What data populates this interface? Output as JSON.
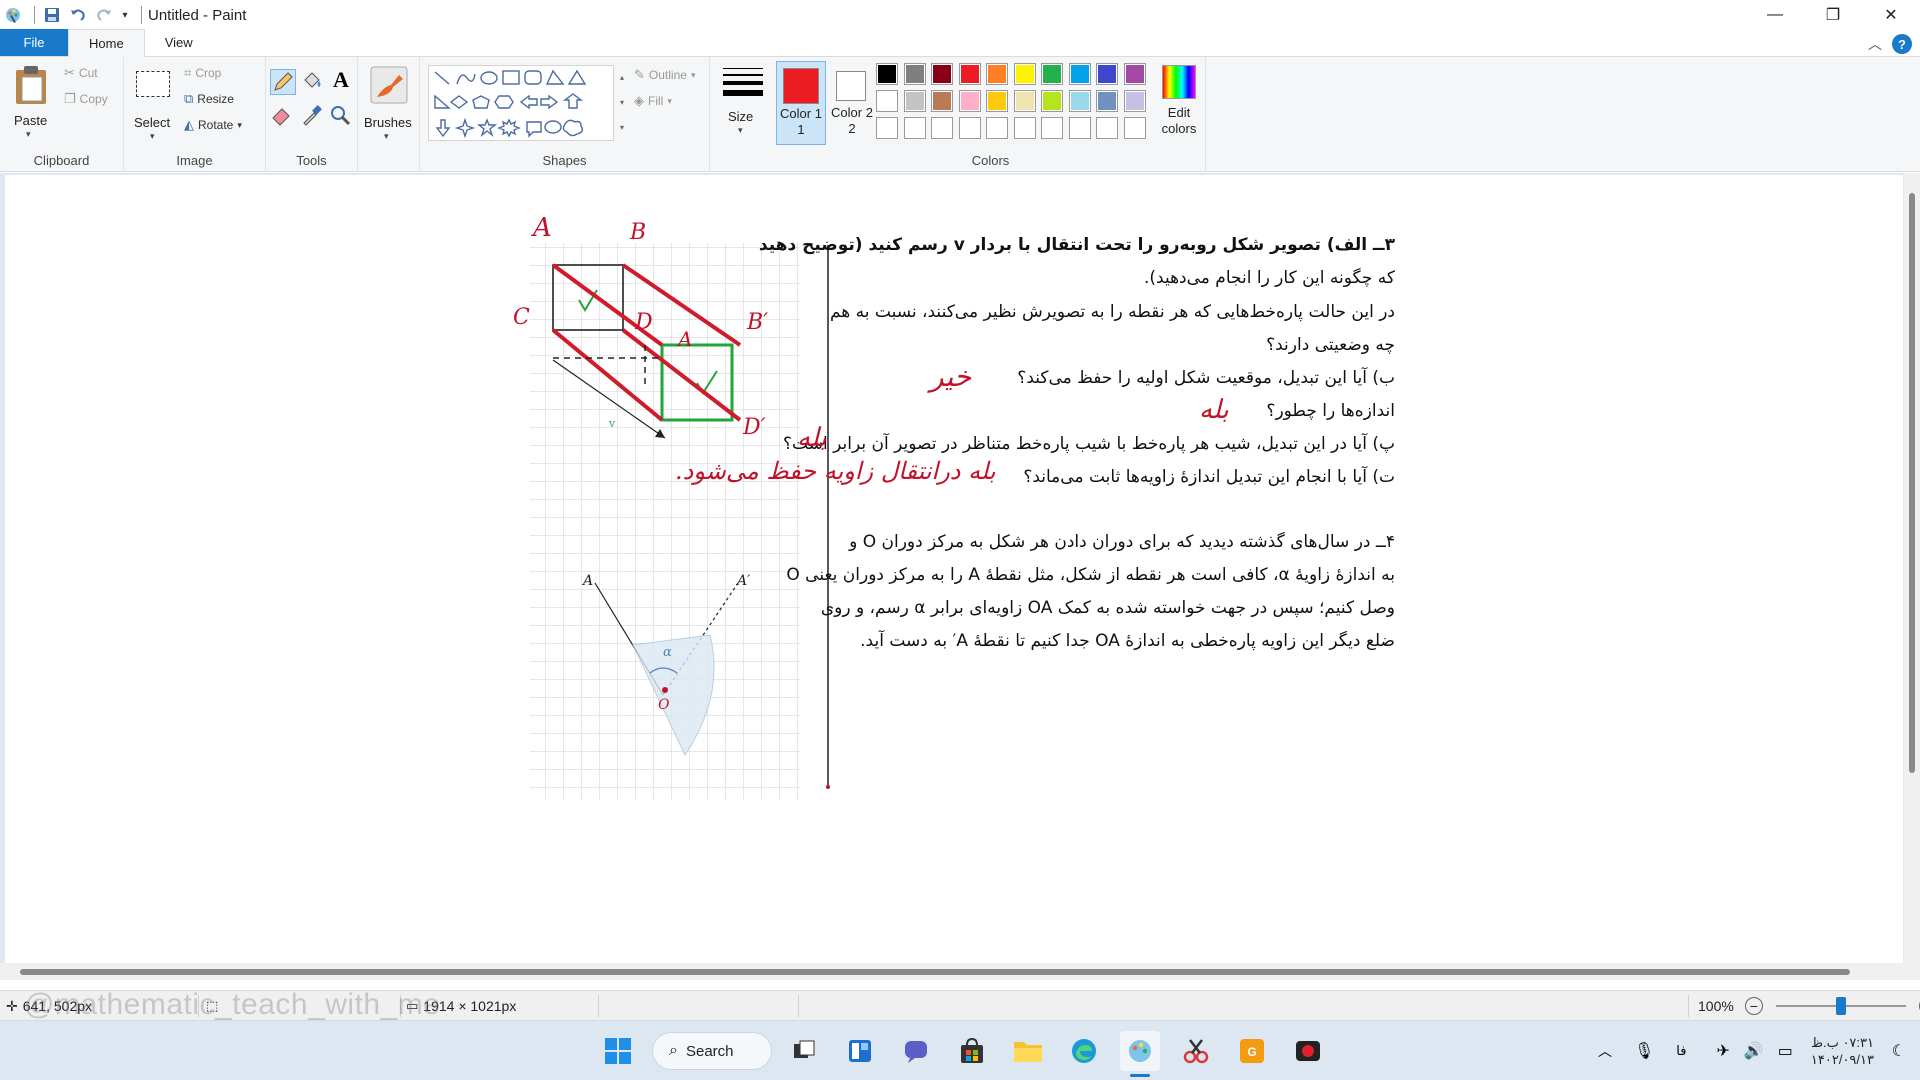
{
  "window": {
    "title": "Untitled - Paint",
    "controls": {
      "minimize": "—",
      "maximize": "❐",
      "close": "✕"
    }
  },
  "tabs": [
    {
      "label": "File"
    },
    {
      "label": "Home"
    },
    {
      "label": "View"
    }
  ],
  "ribbon": {
    "clipboard": {
      "label": "Clipboard",
      "paste": "Paste",
      "cut": "Cut",
      "copy": "Copy"
    },
    "image": {
      "label": "Image",
      "select": "Select",
      "crop": "Crop",
      "resize": "Resize",
      "rotate": "Rotate"
    },
    "tools": {
      "label": "Tools",
      "brushes": "Brushes"
    },
    "shapes": {
      "label": "Shapes",
      "outline": "Outline",
      "fill": "Fill"
    },
    "size": {
      "label": "Size"
    },
    "colors": {
      "label": "Colors",
      "color1": "Color 1",
      "color1_num": "1",
      "color2": "Color 2",
      "color2_num": "2",
      "edit_colors": "Edit colors",
      "edit_label_1": "Edit",
      "edit_label_2": "colors",
      "color1_value": "#ed1c24",
      "color2_value": "#ffffff",
      "palette_row1": [
        "#000000",
        "#7f7f7f",
        "#880015",
        "#ed1c24",
        "#ff7f27",
        "#fff200",
        "#22b14c",
        "#00a2e8",
        "#3f48cc",
        "#a349a4"
      ],
      "palette_row2": [
        "#ffffff",
        "#c3c3c3",
        "#b97a57",
        "#ffaec9",
        "#ffc90e",
        "#efe4b0",
        "#b5e61d",
        "#99d9ea",
        "#7092be",
        "#c8bfe7"
      ]
    }
  },
  "document": {
    "q3_line1": "۳ــ الف) تصویر شکل روبه‌رو را تحت انتقال با بردار v رسم کنید (توضیح دهید",
    "q3_line2": "که چگونه این کار را انجام می‌دهید).",
    "q3_line3": "در این حالت پاره‌خط‌هایی که هر نقطه را به تصویرش نظیر می‌کنند، نسبت به هم",
    "q3_line4": "چه وضعیتی دارند؟",
    "q3_b": "ب) آیا این تبدیل، موقعیت شکل اولیه را حفظ می‌کند؟",
    "q3_b2": "اندازه‌ها را چطور؟",
    "q3_p": "پ) آیا در این تبدیل، شیب هر پاره‌خط با شیب پاره‌خط متناظر در تصویر آن برابر است؟",
    "q3_t": "ت) آیا با انجام این تبدیل اندازهٔ زاویه‌ها ثابت می‌ماند؟",
    "q4_line1": "۴ــ در سال‌های گذشته دیدید که برای دوران دادن هر شکل به مرکز دوران O و",
    "q4_line2": "به اندازهٔ زاویهٔ α، کافی است هر نقطه از شکل، مثل نقطهٔ A را به مرکز دوران یعنی O",
    "q4_line3": "وصل کنیم؛ سپس در جهت خواسته شده به کمک OA زاویه‌ای برابر α رسم، و روی",
    "q4_line4": "ضلع دیگر این زاویه پاره‌خطی به اندازهٔ OA جدا کنیم تا نقطهٔ A′ به دست آید.",
    "ans_b": "خیر",
    "ans_b2": "بله",
    "ans_p": "بله",
    "ans_t": "بله درانتقال زاویه حفظ می‌شود.",
    "fig_labels": {
      "A": "A",
      "B": "B",
      "C": "C",
      "D": "D",
      "A_img": "A",
      "B_img": "B′",
      "D_img": "D′",
      "v": "v",
      "rot_A": "A",
      "rot_A_img": "A′",
      "rot_O": "O",
      "alpha": "α"
    }
  },
  "statusbar": {
    "cursor_pos": "641, 502px",
    "canvas_size": "1914 × 1021px",
    "zoom": "100%",
    "zoom_level": 0.5,
    "watermark": "@mathematic_teach_with_me"
  },
  "taskbar": {
    "search_label": "Search",
    "tray_lang": "فا",
    "clock_time": "۰۷:۳۱ ب.ظ",
    "clock_date": "۱۴۰۲/۰۹/۱۳"
  }
}
